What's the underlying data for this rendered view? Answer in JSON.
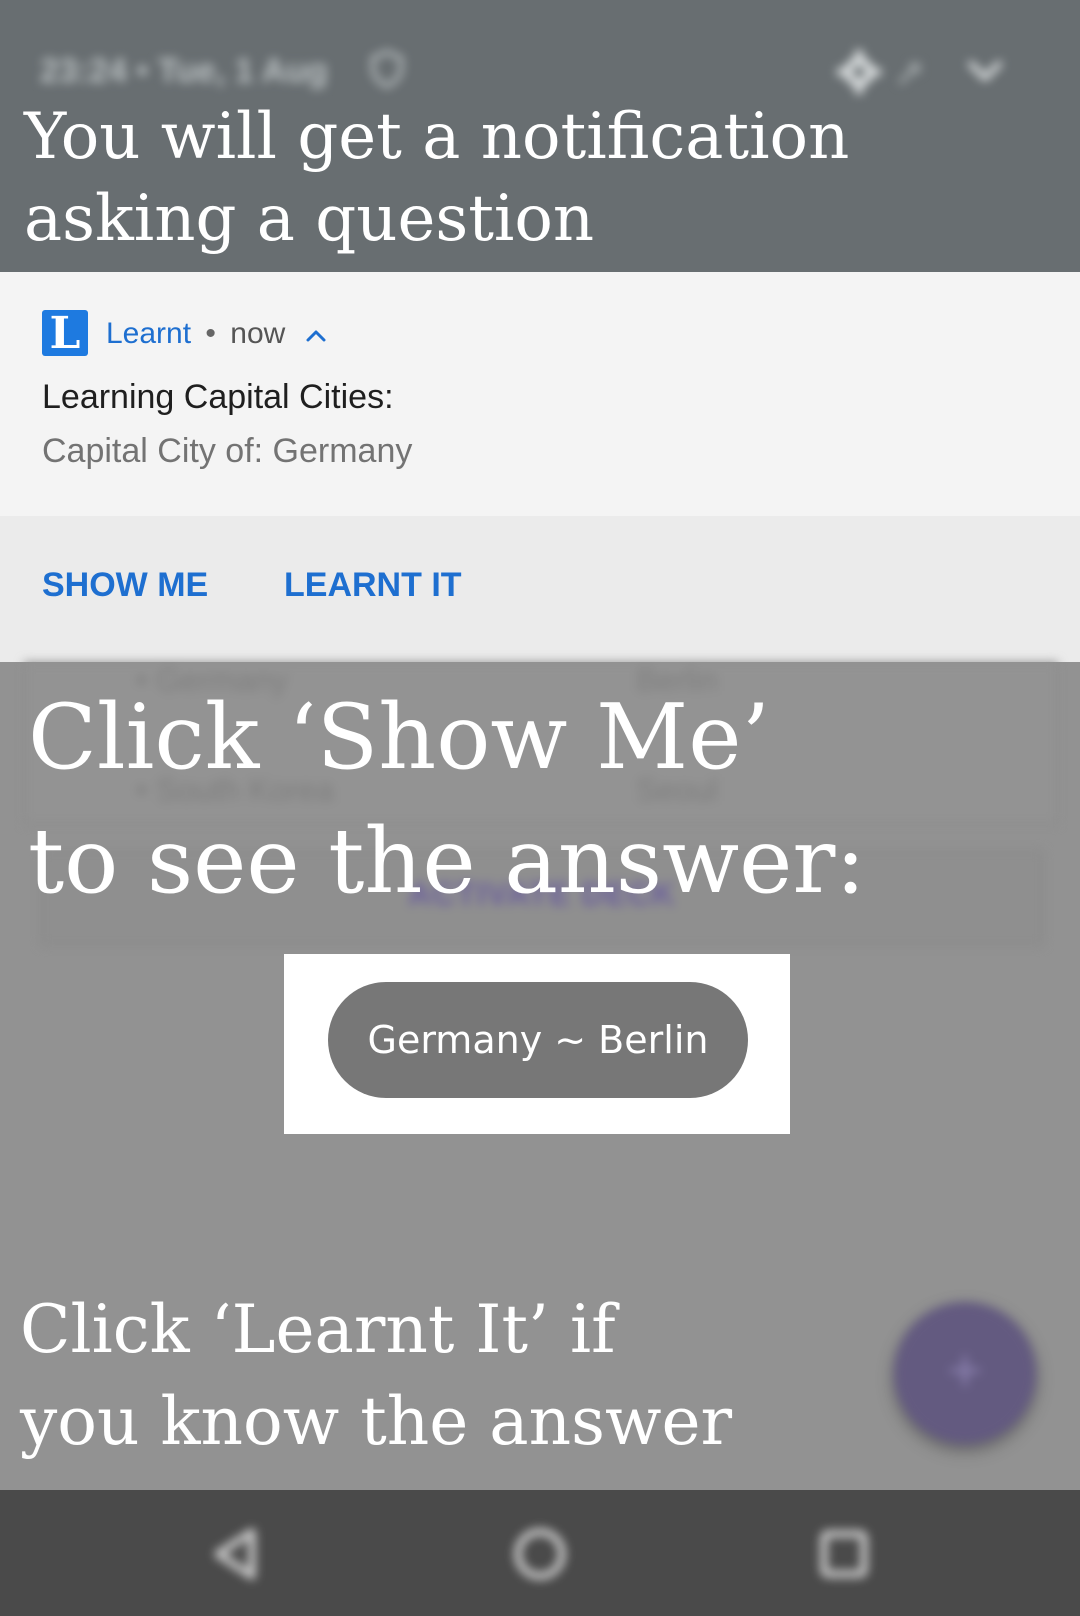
{
  "status_bar": {
    "time_date": "23:24 • Tue, 1 Aug",
    "icons": [
      "shield-icon",
      "gear-icon",
      "wrench-icon",
      "chevron-down-icon"
    ]
  },
  "overlay": {
    "headline_top": "You will get a notification\nasking a question",
    "headline_middle": "Click ‘Show Me’\nto see the answer:",
    "headline_bottom": "Click ‘Learnt It’ if\nyou know the answer",
    "answer_example": "Germany ~ Berlin"
  },
  "notification": {
    "app_icon_letter": "L",
    "app_name": "Learnt",
    "separator": "•",
    "time": "now",
    "title": "Learning Capital Cities:",
    "body": "Capital City of: Germany",
    "actions": {
      "show_me": "SHOW ME",
      "learnt_it": "LEARNT IT"
    },
    "accent_color": "#1e6fd0"
  },
  "background_app": {
    "rows": [
      {
        "country": "• Germany",
        "city": "Berlin"
      },
      {
        "country": "• South Korea",
        "city": "Seoul"
      }
    ],
    "button_label": "ACTIVATE DECK",
    "fab_label": "+"
  },
  "nav_bar": {
    "buttons": [
      "back-icon",
      "home-icon",
      "recents-icon"
    ]
  }
}
